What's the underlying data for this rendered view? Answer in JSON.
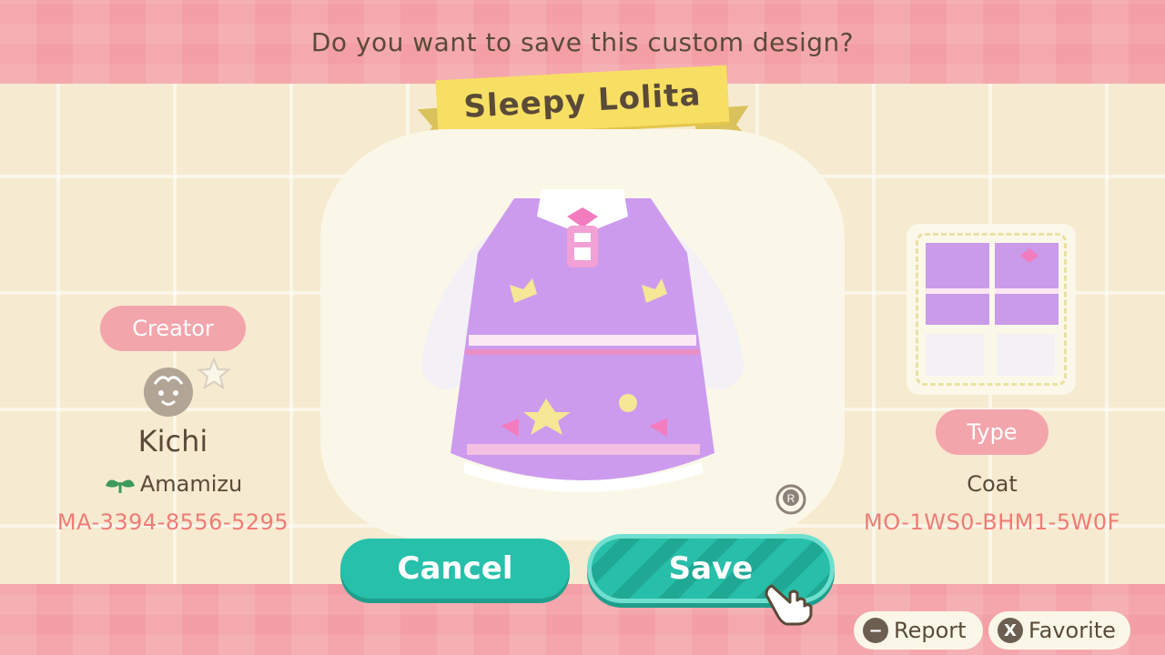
{
  "prompt": "Do you want to save this custom design?",
  "design": {
    "title": "Sleepy Lolita",
    "type_label": "Type",
    "type_value": "Coat",
    "design_code": "MO-1WS0-BHM1-5W0F"
  },
  "creator": {
    "label": "Creator",
    "name": "Kichi",
    "island": "Amamizu",
    "creator_code": "MA-3394-8556-5295"
  },
  "buttons": {
    "cancel": "Cancel",
    "save": "Save"
  },
  "hints": {
    "report_key": "−",
    "report": "Report",
    "favorite_key": "X",
    "favorite": "Favorite"
  },
  "icons": [
    "avatar-face-icon",
    "star-icon",
    "sprout-icon",
    "r-stick-icon",
    "pointer-hand-icon"
  ],
  "colors": {
    "accent_pink": "#f3a5ac",
    "teal": "#27c0aa",
    "banner_yellow": "#f7df63",
    "code_red": "#ef7c76",
    "dress_purple": "#cc9bee"
  }
}
